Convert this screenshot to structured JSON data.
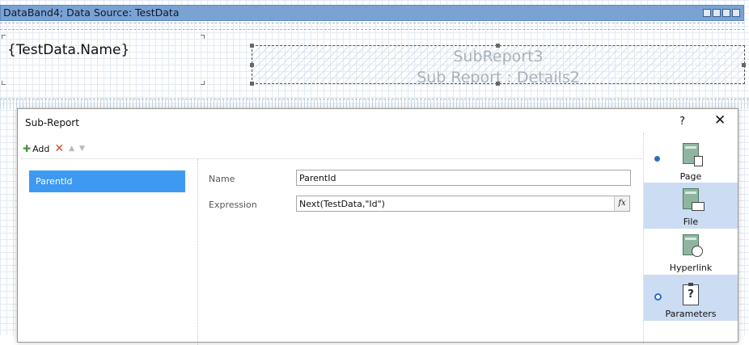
{
  "band": {
    "title": "DataBand4; Data Source: TestData",
    "field_text": "{TestData.Name}",
    "subreport_line1": "SubReport3",
    "subreport_line2": "Sub Report : Details2"
  },
  "dialog": {
    "title": "Sub-Report",
    "help_glyph": "?",
    "close_glyph": "✕",
    "toolbar": {
      "add_label": "Add",
      "delete_glyph": "✕",
      "up_glyph": "▲",
      "down_glyph": "▼"
    },
    "parameters_list": [
      "ParentId"
    ],
    "form": {
      "name_label": "Name",
      "name_value": "ParentId",
      "expression_label": "Expression",
      "expression_value": "Next(TestData,\"Id\")",
      "fx_glyph": "fx"
    },
    "side_panel": {
      "items": [
        {
          "label": "Page",
          "icon": "page-icon"
        },
        {
          "label": "File",
          "icon": "file-icon"
        },
        {
          "label": "Hyperlink",
          "icon": "hyperlink-icon"
        },
        {
          "label": "Parameters",
          "icon": "parameters-icon"
        }
      ]
    }
  },
  "colors": {
    "band_header": "#7aa3d4",
    "selection": "#3d99f2",
    "side_selected": "#ccdcf2"
  }
}
